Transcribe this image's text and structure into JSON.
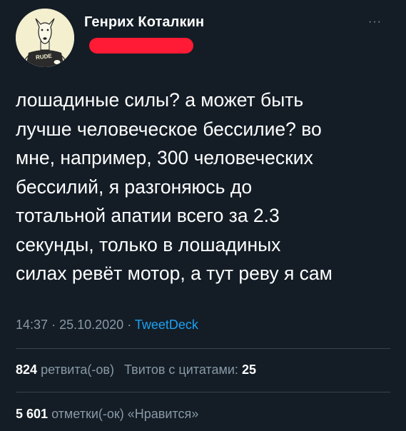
{
  "author": {
    "name": "Генрих Коталкин",
    "avatar_shirt_text": "RUDE"
  },
  "tweet": {
    "text": "лошадиные силы? а может быть\nлучше человеческое бессилие? во\nмне, например, 300 человеческих\nбессилий, я разгоняюсь до\nтотальной апатии всего за 2.3\nсекунды, только в лошадиных\nсилах ревёт мотор, а тут реву я сам",
    "time": "14:37",
    "date": "25.10.2020",
    "separator": "·",
    "source": "TweetDeck"
  },
  "stats": {
    "retweets_count": "824",
    "retweets_label": "ретвита(-ов)",
    "quotes_label": "Твитов с цитатами:",
    "quotes_count": "25",
    "likes_count": "5 601",
    "likes_label": "отметки(-ок) «Нравится»"
  },
  "more_glyph": "···",
  "colors": {
    "background": "#141d26",
    "text": "#ffffff",
    "secondary": "#8899a6",
    "link": "#1da1f2",
    "redaction": "#ff1a35"
  },
  "icons": [
    "more-options-icon"
  ]
}
